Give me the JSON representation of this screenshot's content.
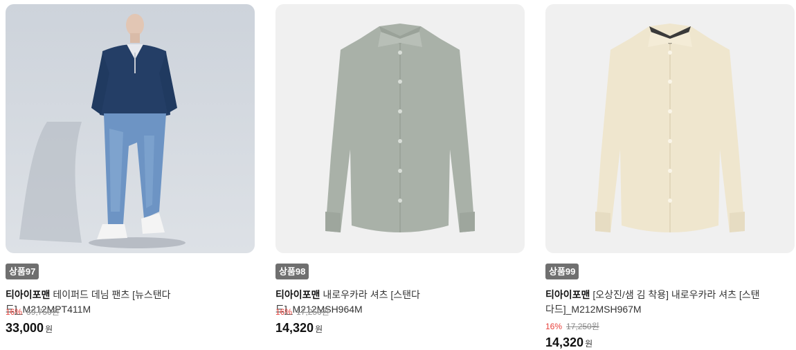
{
  "products": [
    {
      "badge": "상품97",
      "brand": "티아이포맨",
      "name": "테이퍼드 데님 팬츠 [뉴스탠다드]_M212MPT411M",
      "discount": "16%",
      "original_price": "39,750원",
      "sale_price": "33,000",
      "unit": "원",
      "image": "model-in-navy-sweater-and-jeans"
    },
    {
      "badge": "상품98",
      "brand": "티아이포맨",
      "name": "내로우카라 셔츠 [스탠다드]_M212MSH964M",
      "discount": "16%",
      "original_price": "17,250원",
      "sale_price": "14,320",
      "unit": "원",
      "image": "gray-green-dress-shirt",
      "shirt_color": "#a9b1a8"
    },
    {
      "badge": "상품99",
      "brand": "티아이포맨",
      "name": "[오상진/샘 김 착용] 내로우카라 셔츠 [스탠다드]_M212MSH967M",
      "discount": "16%",
      "original_price": "17,250원",
      "sale_price": "14,320",
      "unit": "원",
      "image": "cream-dress-shirt",
      "shirt_color": "#efe6ce"
    }
  ],
  "colors": {
    "badge_bg": "#6f6f6f",
    "discount": "#e8413b",
    "thumb_bg": "#f0f0f0"
  }
}
